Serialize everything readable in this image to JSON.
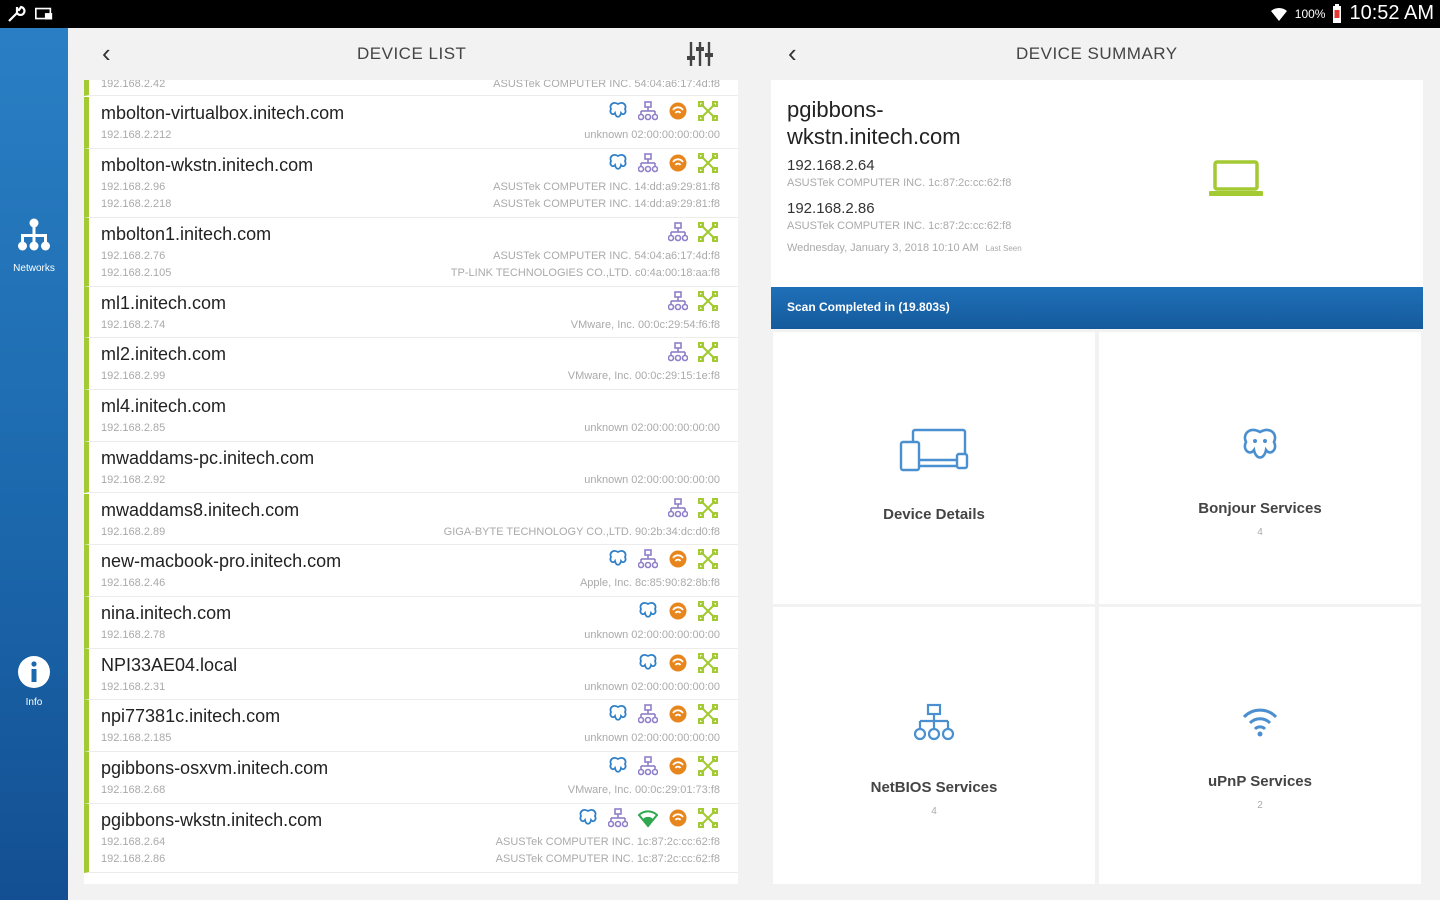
{
  "status_bar": {
    "left_icons": [
      "wrench-icon",
      "screen-icon"
    ],
    "battery_pct": "100%",
    "time": "10:52 AM"
  },
  "rail": {
    "networks_label": "Networks",
    "info_label": "Info"
  },
  "device_list": {
    "title": "DEVICE LIST",
    "top_partial": {
      "ip": "192.168.2.42",
      "vendor": "ASUSTek COMPUTER INC. 54:04:a6:17:4d:f8"
    },
    "rows": [
      {
        "name": "mbolton-virtualbox.initech.com",
        "ips": [
          "192.168.2.212"
        ],
        "vendors": [
          "unknown 02:00:00:00:00:00"
        ],
        "icons": [
          "bonjour",
          "netbios",
          "upnp",
          "network"
        ]
      },
      {
        "name": "mbolton-wkstn.initech.com",
        "ips": [
          "192.168.2.96",
          "192.168.2.218"
        ],
        "vendors": [
          "ASUSTek COMPUTER INC. 14:dd:a9:29:81:f8",
          "ASUSTek COMPUTER INC. 14:dd:a9:29:81:f8"
        ],
        "icons": [
          "bonjour",
          "netbios",
          "upnp",
          "network"
        ]
      },
      {
        "name": "mbolton1.initech.com",
        "ips": [
          "192.168.2.76",
          "192.168.2.105"
        ],
        "vendors": [
          "ASUSTek COMPUTER INC. 54:04:a6:17:4d:f8",
          "TP-LINK TECHNOLOGIES CO.,LTD. c0:4a:00:18:aa:f8"
        ],
        "icons": [
          "netbios",
          "network"
        ]
      },
      {
        "name": "ml1.initech.com",
        "ips": [
          "192.168.2.74"
        ],
        "vendors": [
          "VMware, Inc. 00:0c:29:54:f6:f8"
        ],
        "icons": [
          "netbios",
          "network"
        ]
      },
      {
        "name": "ml2.initech.com",
        "ips": [
          "192.168.2.99"
        ],
        "vendors": [
          "VMware, Inc. 00:0c:29:15:1e:f8"
        ],
        "icons": [
          "netbios",
          "network"
        ]
      },
      {
        "name": "ml4.initech.com",
        "ips": [
          "192.168.2.85"
        ],
        "vendors": [
          "unknown 02:00:00:00:00:00"
        ],
        "icons": []
      },
      {
        "name": "mwaddams-pc.initech.com",
        "ips": [
          "192.168.2.92"
        ],
        "vendors": [
          "unknown 02:00:00:00:00:00"
        ],
        "icons": []
      },
      {
        "name": "mwaddams8.initech.com",
        "ips": [
          "192.168.2.89"
        ],
        "vendors": [
          "GIGA-BYTE TECHNOLOGY CO.,LTD. 90:2b:34:dc:d0:f8"
        ],
        "icons": [
          "netbios",
          "network"
        ]
      },
      {
        "name": "new-macbook-pro.initech.com",
        "ips": [
          "192.168.2.46"
        ],
        "vendors": [
          "Apple, Inc. 8c:85:90:82:8b:f8"
        ],
        "icons": [
          "bonjour",
          "netbios",
          "upnp",
          "network"
        ]
      },
      {
        "name": "nina.initech.com",
        "ips": [
          "192.168.2.78"
        ],
        "vendors": [
          "unknown 02:00:00:00:00:00"
        ],
        "icons": [
          "bonjour",
          "upnp",
          "network"
        ]
      },
      {
        "name": "NPI33AE04.local",
        "ips": [
          "192.168.2.31"
        ],
        "vendors": [
          "unknown 02:00:00:00:00:00"
        ],
        "icons": [
          "bonjour",
          "upnp",
          "network"
        ]
      },
      {
        "name": "npi77381c.initech.com",
        "ips": [
          "192.168.2.185"
        ],
        "vendors": [
          "unknown 02:00:00:00:00:00"
        ],
        "icons": [
          "bonjour",
          "netbios",
          "upnp",
          "network"
        ]
      },
      {
        "name": "pgibbons-osxvm.initech.com",
        "ips": [
          "192.168.2.68"
        ],
        "vendors": [
          "VMware, Inc. 00:0c:29:01:73:f8"
        ],
        "icons": [
          "bonjour",
          "netbios",
          "upnp",
          "network"
        ]
      },
      {
        "name": "pgibbons-wkstn.initech.com",
        "ips": [
          "192.168.2.64",
          "192.168.2.86"
        ],
        "vendors": [
          "ASUSTek COMPUTER INC. 1c:87:2c:cc:62:f8",
          "ASUSTek COMPUTER INC. 1c:87:2c:cc:62:f8"
        ],
        "icons": [
          "bonjour",
          "netbios",
          "wifi",
          "upnp",
          "network"
        ]
      }
    ]
  },
  "summary": {
    "title": "DEVICE SUMMARY",
    "name": "pgibbons-wkstn.initech.com",
    "name_line1": "pgibbons-",
    "name_line2": "wkstn.initech.com",
    "ip1": "192.168.2.64",
    "vendor1": "ASUSTek COMPUTER INC. 1c:87:2c:cc:62:f8",
    "ip2": "192.168.2.86",
    "vendor2": "ASUSTek COMPUTER INC. 1c:87:2c:cc:62:f8",
    "date": "Wednesday, January 3, 2018 10:10 AM",
    "last_seen": "Last Seen",
    "scan_text": "Scan Completed in (19.803s)",
    "tiles": {
      "details": {
        "label": "Device Details"
      },
      "bonjour": {
        "label": "Bonjour Services",
        "count": "4"
      },
      "netbios": {
        "label": "NetBIOS Services",
        "count": "4"
      },
      "upnp": {
        "label": "uPnP Services",
        "count": "2"
      }
    }
  },
  "colors": {
    "accent_green": "#a3c933",
    "blue": "#1f70b8",
    "orange": "#e8861e",
    "purple": "#8f7fc8"
  }
}
